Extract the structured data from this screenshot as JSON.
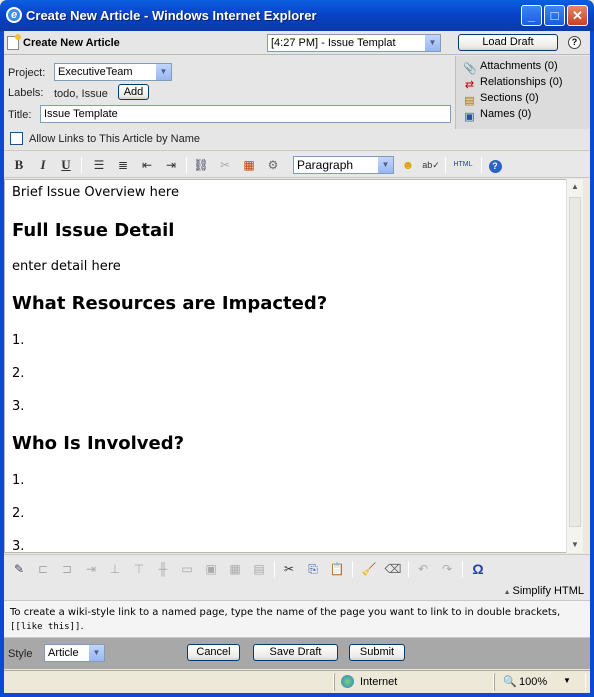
{
  "window": {
    "title": "Create New Article - Windows Internet Explorer",
    "app_icon": "ie-icon"
  },
  "header": {
    "title": "Create New Article",
    "draft_select_value": "[4:27 PM] - Issue Templat",
    "load_draft_label": "Load Draft",
    "help_glyph": "?"
  },
  "form": {
    "project_label": "Project:",
    "project_value": "ExecutiveTeam",
    "labels_label": "Labels:",
    "labels_value": "todo, Issue",
    "add_label": "Add",
    "title_label": "Title:",
    "title_value": "Issue Template",
    "allow_links_label": "Allow Links to This Article by Name"
  },
  "side": {
    "attachments": "Attachments (0)",
    "relationships": "Relationships (0)",
    "sections": "Sections (0)",
    "names": "Names (0)"
  },
  "toolbar": {
    "bold": "B",
    "italic": "I",
    "underline": "U",
    "format_value": "Paragraph",
    "html_label": "HTML"
  },
  "editor": {
    "blocks": [
      {
        "type": "p",
        "text": "Brief Issue Overview here"
      },
      {
        "type": "h",
        "text": "Full Issue Detail"
      },
      {
        "type": "p",
        "text": "enter detail here"
      },
      {
        "type": "h",
        "text": "What Resources are Impacted?"
      },
      {
        "type": "p",
        "text": "1."
      },
      {
        "type": "p",
        "text": "2."
      },
      {
        "type": "p",
        "text": "3."
      },
      {
        "type": "h",
        "text": "Who Is Involved?"
      },
      {
        "type": "p",
        "text": "1."
      },
      {
        "type": "p",
        "text": "2."
      },
      {
        "type": "p",
        "text": "3."
      }
    ]
  },
  "bottom_toolbar": {
    "omega": "Ω",
    "simplify_label": "Simplify HTML"
  },
  "hint": {
    "text": "To create a wiki-style link to a named page, type the name of the page you want to link to in double brackets, ",
    "code": "[[like this]]",
    "end": "."
  },
  "footer": {
    "style_label": "Style",
    "style_value": "Article",
    "cancel_label": "Cancel",
    "save_draft_label": "Save Draft",
    "submit_label": "Submit"
  },
  "statusbar": {
    "zone": "Internet",
    "zoom": "100%"
  },
  "colors": {
    "titlebar": "#0a49d2",
    "panel": "#e6e6e6",
    "footer": "#a8a8a8"
  }
}
